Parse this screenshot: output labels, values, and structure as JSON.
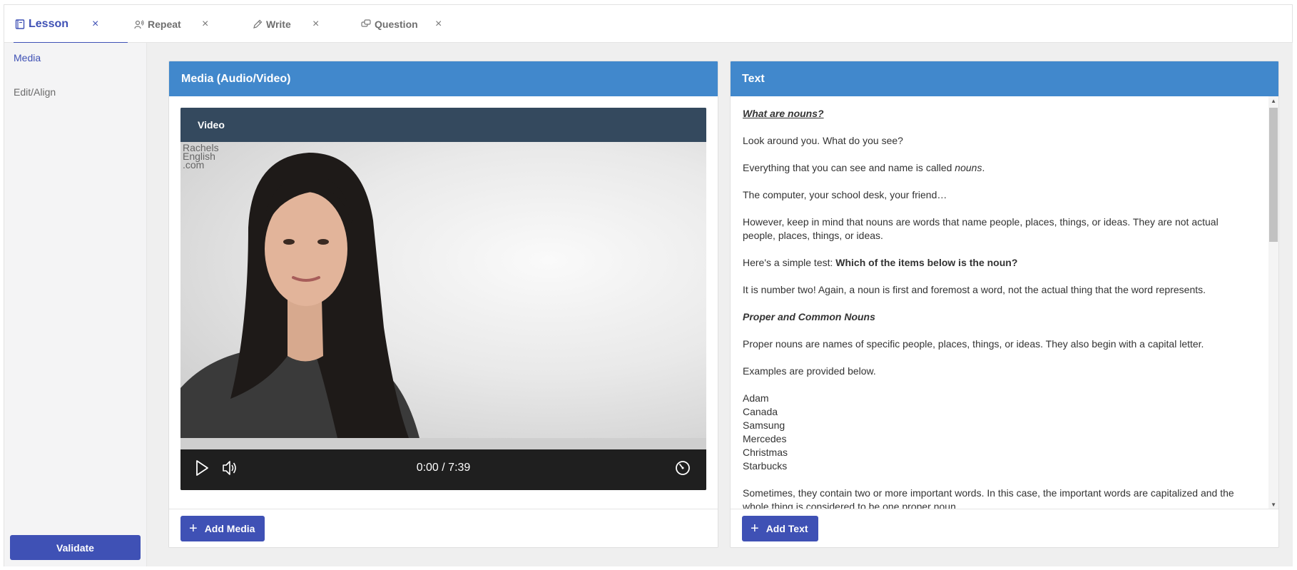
{
  "tabs": [
    {
      "label": "Lesson",
      "icon": "book-icon",
      "active": true
    },
    {
      "label": "Repeat",
      "icon": "repeat-speak-icon",
      "active": false
    },
    {
      "label": "Write",
      "icon": "pencil-icon",
      "active": false
    },
    {
      "label": "Question",
      "icon": "chat-question-icon",
      "active": false
    }
  ],
  "close_glyph": "×",
  "sidebar": {
    "items": [
      {
        "label": "Media",
        "active": true
      },
      {
        "label": "Edit/Align",
        "active": false
      }
    ],
    "validate_label": "Validate"
  },
  "media_panel": {
    "title": "Media (Audio/Video)",
    "player_title": "Video",
    "watermark": [
      "Rachels",
      "English",
      ".com"
    ],
    "time": "0:00 / 7:39",
    "add_label": "Add Media"
  },
  "text_panel": {
    "title": "Text",
    "heading": "What are nouns?",
    "p1": "Look around you. What do you see?",
    "p2_before": "Everything that you can see and name is called ",
    "p2_em": "nouns",
    "p2_after": ".",
    "p3": "The computer, your school desk, your friend…",
    "p4": "However, keep in mind that nouns are words that name people, places, things, or ideas. They are not actual people, places, things, or ideas.",
    "p5_before": "Here's a simple test: ",
    "p5_bold": "Which of the items below is the noun?",
    "p6": "It is number two! Again, a noun is first and foremost a word, not the actual thing that the word represents.",
    "subheading": "Proper and Common Nouns",
    "p7": "Proper nouns are names of specific people, places, things, or ideas. They also begin with a capital letter.",
    "p8": "Examples are provided below.",
    "examples": [
      "Adam",
      "Canada",
      "Samsung",
      "Mercedes",
      "Christmas",
      "Starbucks"
    ],
    "p9": "Sometimes, they contain two or more important words. In this case, the important words are capitalized and the whole thing is considered to be one proper noun.",
    "add_label": "Add Text"
  },
  "colors": {
    "accent": "#3f51b5",
    "panel_header": "#4188cc",
    "player_header": "#34495e"
  }
}
